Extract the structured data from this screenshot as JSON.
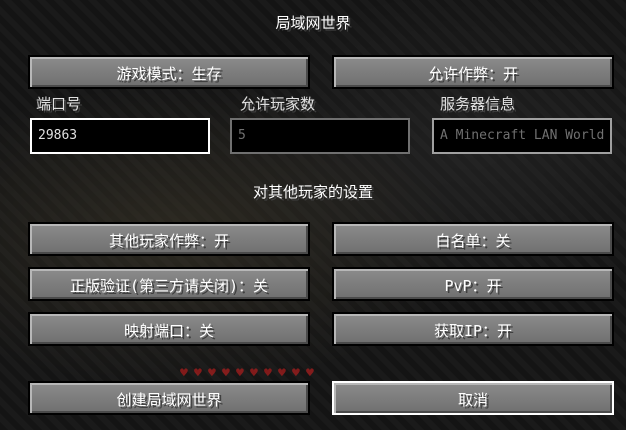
{
  "title": "局域网世界",
  "top_buttons": {
    "game_mode": "游戏模式：生存",
    "allow_cheats": "允许作弊：开"
  },
  "fields": {
    "port": {
      "label": "端口号",
      "value": "29863"
    },
    "max_players": {
      "label": "允许玩家数",
      "value": "5"
    },
    "motd": {
      "label": "服务器信息",
      "placeholder": "A Minecraft LAN World"
    }
  },
  "section_title": "对其他玩家的设置",
  "settings": {
    "others_cheats": "其他玩家作弊：开",
    "whitelist": "白名单：关",
    "online_mode": "正版验证(第三方请关闭)：关",
    "pvp": "PvP：开",
    "port_mapping": "映射端口：关",
    "get_ip": "获取IP：开"
  },
  "bottom_buttons": {
    "create": "创建局域网世界",
    "cancel": "取消"
  },
  "colors": {
    "button_face": "#7b7b7b",
    "focus_border": "#ffffff",
    "text": "#ffffff"
  }
}
